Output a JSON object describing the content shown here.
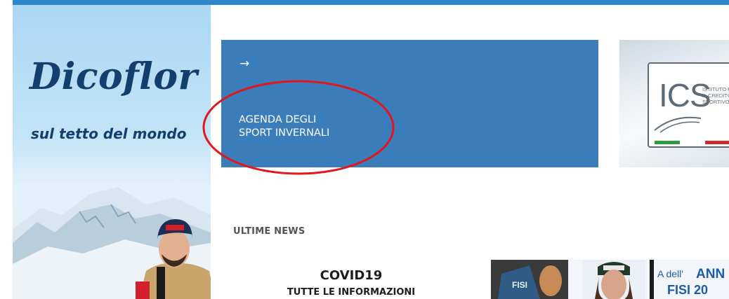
{
  "ad": {
    "title": "Dicoflor",
    "subtitle": "sul tetto del mondo"
  },
  "agenda": {
    "arrow": "→",
    "label_line1": "AGENDA DEGLI",
    "label_line2": "SPORT INVERNALI"
  },
  "ics": {
    "logo": "ICS",
    "desc_line1": "ISTITUTO PER",
    "desc_line2": "IL CREDITO",
    "desc_line3": "SPORTIVO"
  },
  "news": {
    "section_title": "ULTIME NEWS",
    "covid_title": "COVID19",
    "covid_subtitle": "TUTTE LE INFORMAZIONI"
  },
  "photo": {
    "banner_prefix": "A dell'",
    "banner_main": "ANN",
    "banner_year": "FISI 20",
    "jersey": "FISI"
  },
  "colors": {
    "topbar": "#2c86c9",
    "agenda_bg": "#3b7cbb",
    "annotation": "#e3161b"
  }
}
